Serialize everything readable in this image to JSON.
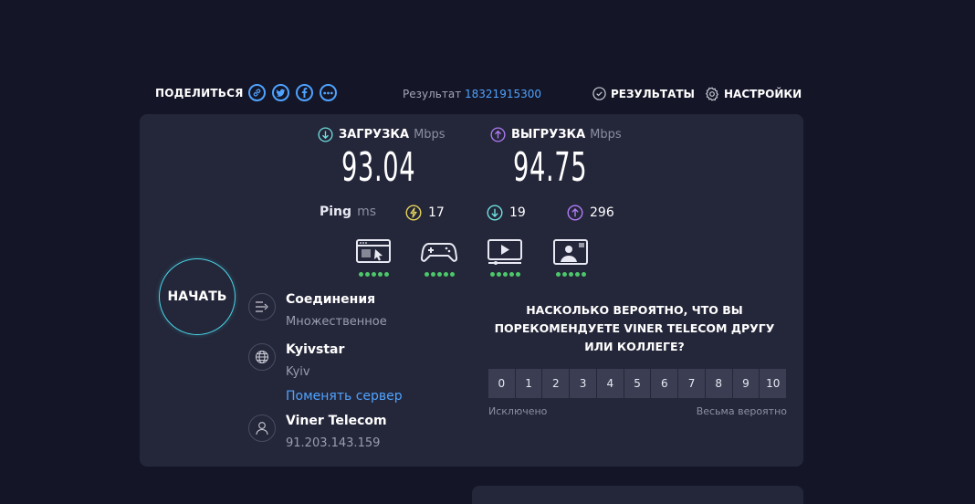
{
  "header": {
    "share_label": "ПОДЕЛИТЬСЯ",
    "share_icons": [
      "link-icon",
      "twitter-icon",
      "facebook-icon",
      "more-icon"
    ],
    "result_label": "Результат",
    "result_id": "18321915300",
    "results_label": "РЕЗУЛЬТАТЫ",
    "settings_label": "НАСТРОЙКИ"
  },
  "download": {
    "label": "ЗАГРУЗКА",
    "unit": "Mbps",
    "value": "93.04",
    "color": "#6ee0e0"
  },
  "upload": {
    "label": "ВЫГРУЗКА",
    "unit": "Mbps",
    "value": "94.75",
    "color": "#b07cf5"
  },
  "ping": {
    "label": "Ping",
    "unit": "ms",
    "idle": "17",
    "download": "19",
    "upload": "296",
    "idle_color": "#e6d35a"
  },
  "quality_icons": [
    {
      "name": "browsing-icon",
      "rating": 5
    },
    {
      "name": "gaming-icon",
      "rating": 5
    },
    {
      "name": "streaming-icon",
      "rating": 5
    },
    {
      "name": "video-call-icon",
      "rating": 5
    }
  ],
  "start_label": "НАЧАТЬ",
  "connections": {
    "title": "Соединения",
    "value": "Множественное"
  },
  "server": {
    "title": "Kyivstar",
    "city": "Kyiv",
    "change_label": "Поменять сервер"
  },
  "provider": {
    "title": "Viner Telecom",
    "ip": "91.203.143.159"
  },
  "survey": {
    "question": "НАСКОЛЬКО ВЕРОЯТНО, ЧТО ВЫ ПОРЕКОМЕНДУЕТЕ VINER TELECOM ДРУГУ ИЛИ КОЛЛЕГЕ?",
    "scale": [
      "0",
      "1",
      "2",
      "3",
      "4",
      "5",
      "6",
      "7",
      "8",
      "9",
      "10"
    ],
    "low_label": "Исключено",
    "high_label": "Весьма вероятно"
  },
  "colors": {
    "accent": "#4fa3ff",
    "good": "#4cc769",
    "start_ring": "#49d6e8"
  }
}
